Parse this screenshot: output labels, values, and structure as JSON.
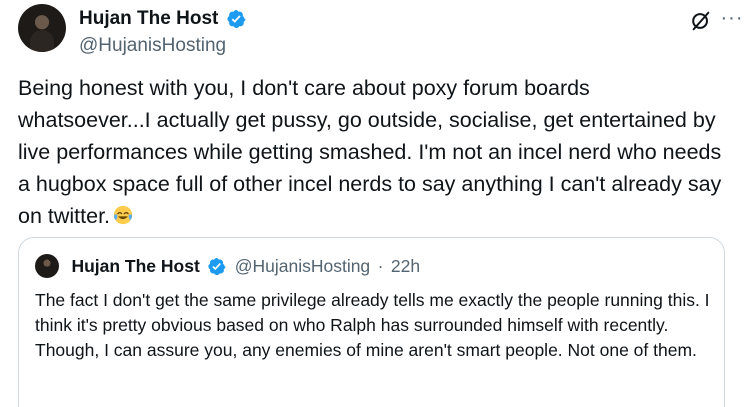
{
  "tweet": {
    "author": {
      "display_name": "Hujan The Host",
      "handle": "@HujanisHosting",
      "verified_icon": "verified-badge-icon",
      "avatar": "avatar"
    },
    "text": "Being honest with you, I don't care about poxy forum boards whatsoever...I actually get pussy, go outside, socialise, get entertained by live performances while getting smashed. I'm not an incel nerd who needs a hugbox space full of other incel nerds to say anything I can't already say on twitter.",
    "emoji": "face-with-tears-of-joy",
    "header_icons": [
      "grok-icon",
      "more-options-icon"
    ]
  },
  "quoted_tweet": {
    "author": {
      "display_name": "Hujan The Host",
      "handle": "@HujanisHosting",
      "separator": "·",
      "time": "22h"
    },
    "text": "The fact I don't get the same privilege already tells me exactly the people running this. I think it's pretty obvious based on who Ralph has surrounded himself with recently. Though, I can assure you, any enemies of mine aren't smart people. Not one of them."
  },
  "colors": {
    "text": "#0f1419",
    "secondary": "#536471",
    "verified": "#1d9bf0",
    "border": "#cfd9de"
  }
}
